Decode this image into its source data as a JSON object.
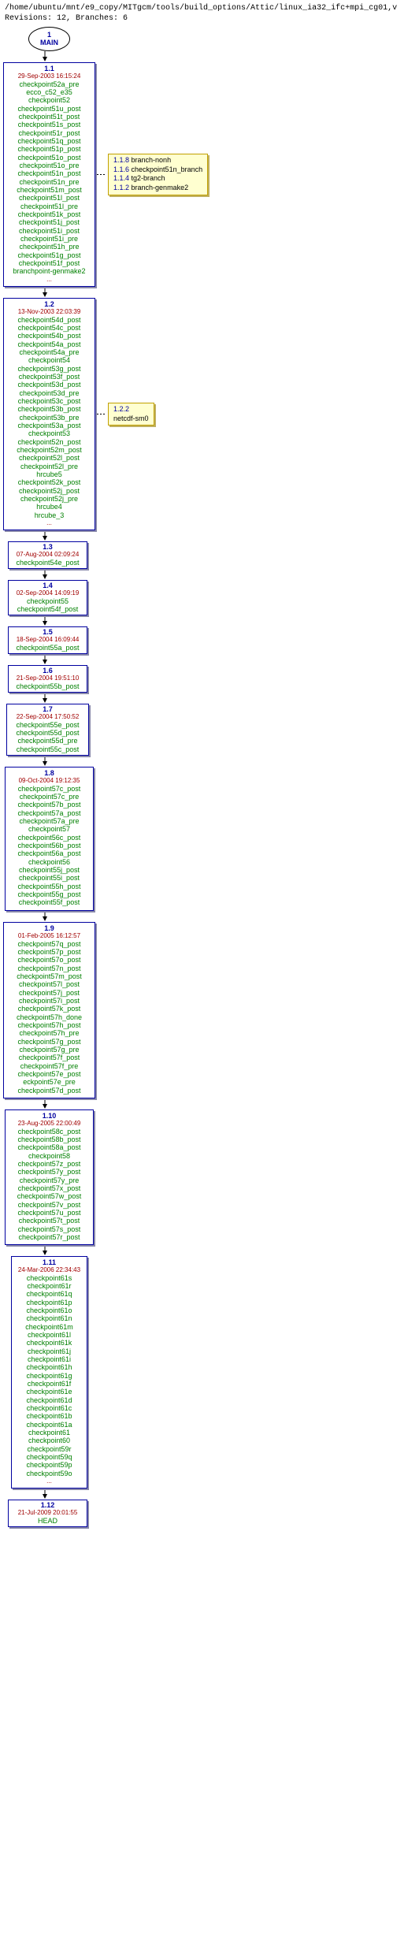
{
  "header": {
    "path": "/home/ubuntu/mnt/e9_copy/MITgcm/tools/build_options/Attic/linux_ia32_ifc+mpi_cg01,v",
    "stats": "Revisions: 12, Branches: 6"
  },
  "nodes": {
    "root": {
      "rev": "1",
      "label": "MAIN"
    },
    "n11": {
      "rev": "1.1",
      "meta": "29-Sep-2003 16:15:24",
      "tags": [
        "checkpoint52a_pre",
        "ecco_c52_e35",
        "checkpoint52",
        "checkpoint51u_post",
        "checkpoint51t_post",
        "checkpoint51s_post",
        "checkpoint51r_post",
        "checkpoint51q_post",
        "checkpoint51p_post",
        "checkpoint51o_post",
        "checkpoint51o_pre",
        "checkpoint51n_post",
        "checkpoint51n_pre",
        "checkpoint51m_post",
        "checkpoint51l_post",
        "checkpoint51l_pre",
        "checkpoint51k_post",
        "checkpoint51j_post",
        "checkpoint51i_post",
        "checkpoint51i_pre",
        "checkpoint51h_pre",
        "checkpoint51g_post",
        "checkpoint51f_post",
        "branchpoint-genmake2"
      ],
      "ellipsis": "..."
    },
    "n12": {
      "rev": "1.2",
      "meta": "13-Nov-2003 22:03:39",
      "tags": [
        "checkpoint54d_post",
        "checkpoint54c_post",
        "checkpoint54b_post",
        "checkpoint54a_post",
        "checkpoint54a_pre",
        "checkpoint54",
        "checkpoint53g_post",
        "checkpoint53f_post",
        "checkpoint53d_post",
        "checkpoint53d_pre",
        "checkpoint53c_post",
        "checkpoint53b_post",
        "checkpoint53b_pre",
        "checkpoint53a_post",
        "checkpoint53",
        "checkpoint52n_post",
        "checkpoint52m_post",
        "checkpoint52l_post",
        "checkpoint52l_pre",
        "hrcube5",
        "checkpoint52k_post",
        "checkpoint52j_post",
        "checkpoint52j_pre",
        "hrcube4",
        "hrcube_3"
      ],
      "ellipsis": "..."
    },
    "n13": {
      "rev": "1.3",
      "meta": "07-Aug-2004 02:09:24",
      "tags": [
        "checkpoint54e_post"
      ]
    },
    "n14": {
      "rev": "1.4",
      "meta": "02-Sep-2004 14:09:19",
      "tags": [
        "checkpoint55",
        "checkpoint54f_post"
      ]
    },
    "n15": {
      "rev": "1.5",
      "meta": "18-Sep-2004 16:09:44",
      "tags": [
        "checkpoint55a_post"
      ]
    },
    "n16": {
      "rev": "1.6",
      "meta": "21-Sep-2004 19:51:10",
      "tags": [
        "checkpoint55b_post"
      ]
    },
    "n17": {
      "rev": "1.7",
      "meta": "22-Sep-2004 17:50:52",
      "tags": [
        "checkpoint55e_post",
        "checkpoint55d_post",
        "checkpoint55d_pre",
        "checkpoint55c_post"
      ]
    },
    "n18": {
      "rev": "1.8",
      "meta": "09-Oct-2004 19:12:35",
      "tags": [
        "checkpoint57c_post",
        "checkpoint57c_pre",
        "checkpoint57b_post",
        "checkpoint57a_post",
        "checkpoint57a_pre",
        "checkpoint57",
        "checkpoint56c_post",
        "checkpoint56b_post",
        "checkpoint56a_post",
        "checkpoint56",
        "checkpoint55j_post",
        "checkpoint55i_post",
        "checkpoint55h_post",
        "checkpoint55g_post",
        "checkpoint55f_post"
      ]
    },
    "n19": {
      "rev": "1.9",
      "meta": "01-Feb-2005 16:12:57",
      "tags": [
        "checkpoint57q_post",
        "checkpoint57p_post",
        "checkpoint57o_post",
        "checkpoint57n_post",
        "checkpoint57m_post",
        "checkpoint57l_post",
        "checkpoint57j_post",
        "checkpoint57i_post",
        "checkpoint57k_post",
        "checkpoint57h_done",
        "checkpoint57h_post",
        "checkpoint57h_pre",
        "checkpoint57g_post",
        "checkpoint57g_pre",
        "checkpoint57f_post",
        "checkpoint57f_pre",
        "checkpoint57e_post",
        "eckpoint57e_pre",
        "checkpoint57d_post"
      ]
    },
    "n110": {
      "rev": "1.10",
      "meta": "23-Aug-2005 22:00:49",
      "tags": [
        "checkpoint58c_post",
        "checkpoint58b_post",
        "checkpoint58a_post",
        "checkpoint58",
        "checkpoint57z_post",
        "checkpoint57y_post",
        "checkpoint57y_pre",
        "checkpoint57x_post",
        "checkpoint57w_post",
        "checkpoint57v_post",
        "checkpoint57u_post",
        "checkpoint57t_post",
        "checkpoint57s_post",
        "checkpoint57r_post"
      ]
    },
    "n111": {
      "rev": "1.11",
      "meta": "24-Mar-2006 22:34:43",
      "tags": [
        "checkpoint61s",
        "checkpoint61r",
        "checkpoint61q",
        "checkpoint61p",
        "checkpoint61o",
        "checkpoint61n",
        "checkpoint61m",
        "checkpoint61l",
        "checkpoint61k",
        "checkpoint61j",
        "checkpoint61i",
        "checkpoint61h",
        "checkpoint61g",
        "checkpoint61f",
        "checkpoint61e",
        "checkpoint61d",
        "checkpoint61c",
        "checkpoint61b",
        "checkpoint61a",
        "checkpoint61",
        "checkpoint60",
        "checkpoint59r",
        "checkpoint59q",
        "checkpoint59p",
        "checkpoint59o"
      ],
      "ellipsis": "..."
    },
    "n112": {
      "rev": "1.12",
      "meta": "21-Jul-2009 20:01:55",
      "tags": [
        "HEAD"
      ]
    },
    "a1": {
      "rows": [
        {
          "k": "1.1.8",
          "v": "branch-nonh"
        },
        {
          "k": "1.1.6",
          "v": "checkpoint51n_branch"
        },
        {
          "k": "1.1.4",
          "v": "tg2-branch"
        },
        {
          "k": "1.1.2",
          "v": "branch-genmake2"
        }
      ]
    },
    "a2": {
      "rows": [
        {
          "k": "1.2.2",
          "v": ""
        },
        {
          "k": "",
          "v": "netcdf-sm0"
        }
      ]
    }
  }
}
